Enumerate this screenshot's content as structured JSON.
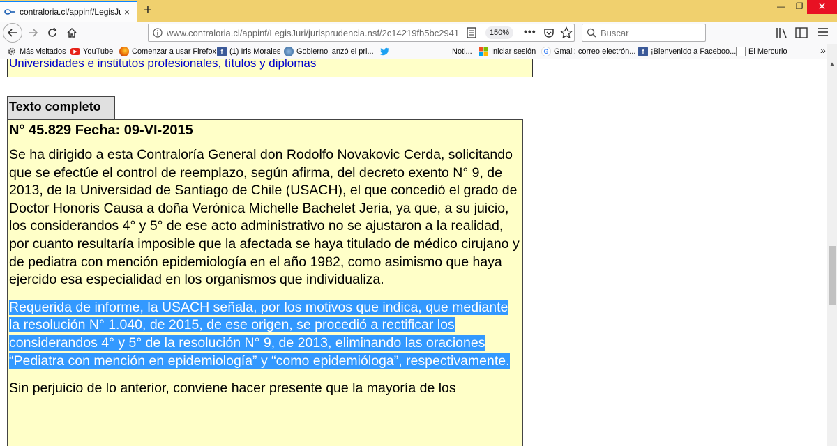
{
  "tab": {
    "title": "contraloria.cl/appinf/LegisJuri/",
    "close": "×"
  },
  "new_tab": "+",
  "window": {
    "minimize": "—",
    "maximize": "❐",
    "close": "✕"
  },
  "nav": {
    "url_host": "www.contraloria.cl",
    "url_path": "/appinf/LegisJuri/jurisprudencia.nsf/2c14219fb5bc2941",
    "zoom": "150%",
    "more": "•••",
    "search_placeholder": "Buscar"
  },
  "bookmarks": [
    {
      "label": "Más visitados",
      "icon": "gear-icon"
    },
    {
      "label": "YouTube",
      "icon": "youtube-icon"
    },
    {
      "label": "Comenzar a usar Firefox",
      "icon": "firefox-icon"
    },
    {
      "label": "(1) Iris Morales",
      "icon": "facebook-icon"
    },
    {
      "label": "Gobierno lanzó el pri...",
      "icon": "globe-icon"
    },
    {
      "label": "",
      "icon": "twitter-icon"
    },
    {
      "label": "Noti...",
      "icon": "none"
    },
    {
      "label": "Iniciar sesión",
      "icon": "microsoft-icon"
    },
    {
      "label": "Gmail: correo electrón...",
      "icon": "google-icon"
    },
    {
      "label": "¡Bienvenido a Faceboo...",
      "icon": "facebook-icon"
    },
    {
      "label": "El Mercurio",
      "icon": "page-icon"
    }
  ],
  "content": {
    "top_link": "Universidades e institutos profesionales, títulos y diplomas",
    "section_header": "Texto completo",
    "doc_title": "N° 45.829 Fecha: 09-VI-2015",
    "para1": "Se ha dirigido a esta Contraloría General don Rodolfo Novakovic Cerda, solicitando que se efectúe el control de reemplazo, según afirma, del decreto exento N° 9, de 2013, de la Universidad de Santiago de Chile (USACH), el que concedió el grado de Doctor Honoris Causa a doña Verónica Michelle Bachelet Jeria, ya que, a su juicio, los considerandos 4° y 5° de ese acto administrativo no se ajustaron a la realidad, por cuanto resultaría imposible que la afectada se haya titulado de médico cirujano y de pediatra con mención epidemiología en el año 1982, como asimismo que haya ejercido esa especialidad en los organismos que individualiza.",
    "para2": "Requerida de informe, la USACH señala, por los motivos que indica, que mediante la resolución N° 1.040, de 2015, de ese origen, se procedió a rectificar los considerandos 4° y 5° de la resolución N° 9, de 2013, eliminando las oraciones “Pediatra con mención en epidemiología” y “como epidemióloga”, respectivamente.",
    "para3": "Sin perjuicio de lo anterior, conviene hacer presente que la mayoría de los"
  },
  "colors": {
    "accent": "#0a84ff",
    "tabbar": "#f0d06e",
    "doc_bg": "#ffffc8",
    "selection": "#3399ff",
    "link": "#0000cc"
  }
}
